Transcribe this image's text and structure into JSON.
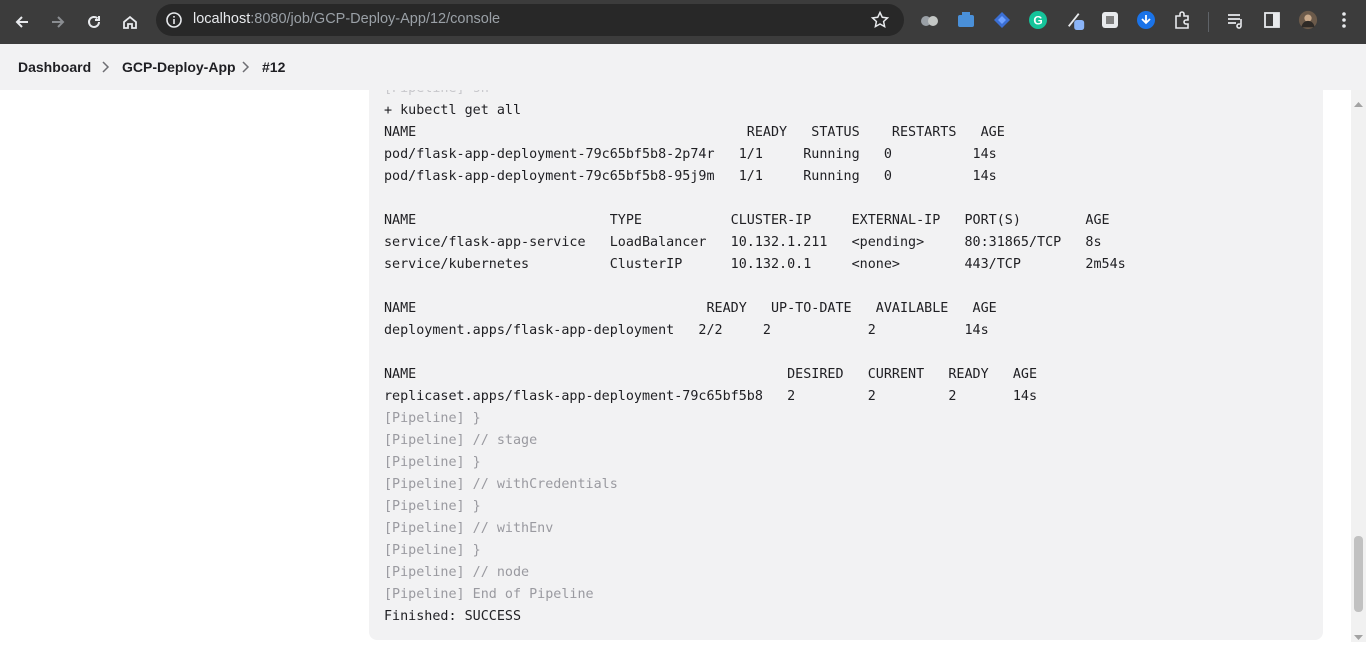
{
  "browser": {
    "url_host": "localhost",
    "url_path": ":8080/job/GCP-Deploy-App/12/console",
    "icons": [
      "back-icon",
      "forward-icon",
      "reload-icon",
      "home-icon",
      "info-icon",
      "bookmark-star-icon"
    ]
  },
  "breadcrumb": {
    "items": [
      "Dashboard",
      "GCP-Deploy-App",
      "#12"
    ]
  },
  "console": {
    "lines": [
      {
        "text": "[Pipeline] sh",
        "style": "clip"
      },
      {
        "text": "+ kubectl get all",
        "style": "normal"
      },
      {
        "text": "NAME                                         READY   STATUS    RESTARTS   AGE",
        "style": "normal"
      },
      {
        "text": "pod/flask-app-deployment-79c65bf5b8-2p74r   1/1     Running   0          14s",
        "style": "normal"
      },
      {
        "text": "pod/flask-app-deployment-79c65bf5b8-95j9m   1/1     Running   0          14s",
        "style": "normal"
      },
      {
        "text": "",
        "style": "normal"
      },
      {
        "text": "NAME                        TYPE           CLUSTER-IP     EXTERNAL-IP   PORT(S)        AGE",
        "style": "normal"
      },
      {
        "text": "service/flask-app-service   LoadBalancer   10.132.1.211   <pending>     80:31865/TCP   8s",
        "style": "normal"
      },
      {
        "text": "service/kubernetes          ClusterIP      10.132.0.1     <none>        443/TCP        2m54s",
        "style": "normal"
      },
      {
        "text": "",
        "style": "normal"
      },
      {
        "text": "NAME                                    READY   UP-TO-DATE   AVAILABLE   AGE",
        "style": "normal"
      },
      {
        "text": "deployment.apps/flask-app-deployment   2/2     2            2           14s",
        "style": "normal"
      },
      {
        "text": "",
        "style": "normal"
      },
      {
        "text": "NAME                                              DESIRED   CURRENT   READY   AGE",
        "style": "normal"
      },
      {
        "text": "replicaset.apps/flask-app-deployment-79c65bf5b8   2         2         2       14s",
        "style": "normal"
      },
      {
        "text": "[Pipeline] }",
        "style": "muted"
      },
      {
        "text": "[Pipeline] // stage",
        "style": "muted"
      },
      {
        "text": "[Pipeline] }",
        "style": "muted"
      },
      {
        "text": "[Pipeline] // withCredentials",
        "style": "muted"
      },
      {
        "text": "[Pipeline] }",
        "style": "muted"
      },
      {
        "text": "[Pipeline] // withEnv",
        "style": "muted"
      },
      {
        "text": "[Pipeline] }",
        "style": "muted"
      },
      {
        "text": "[Pipeline] // node",
        "style": "muted"
      },
      {
        "text": "[Pipeline] End of Pipeline",
        "style": "muted"
      },
      {
        "text": "Finished: SUCCESS",
        "style": "normal"
      }
    ]
  }
}
